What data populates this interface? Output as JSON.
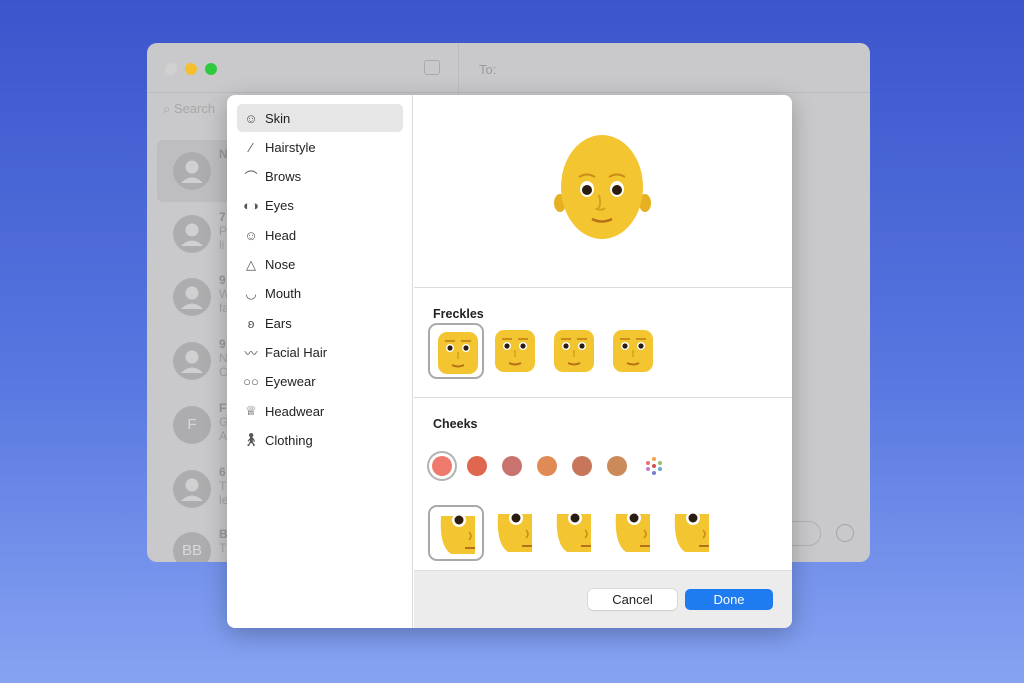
{
  "background_colors": [
    "#3b55cc",
    "#86a3f2"
  ],
  "messages_window": {
    "search_placeholder": "Search",
    "to_label": "To:",
    "traffic_lights": [
      "#d1d1d1",
      "#f5bf2f",
      "#2fc940"
    ],
    "conversations": [
      {
        "avatar": "",
        "lines": [
          "N",
          "",
          ""
        ]
      },
      {
        "avatar": "",
        "lines": [
          "7",
          "P",
          "li"
        ]
      },
      {
        "avatar": "",
        "lines": [
          "9",
          "W",
          "fa"
        ]
      },
      {
        "avatar": "",
        "lines": [
          "9",
          "N",
          "C"
        ]
      },
      {
        "avatar": "F",
        "lines": [
          "F",
          "G",
          "A"
        ]
      },
      {
        "avatar": "",
        "lines": [
          "6",
          "T",
          "le"
        ]
      },
      {
        "avatar": "BB",
        "lines": [
          "B",
          "T",
          ""
        ]
      }
    ]
  },
  "dialog": {
    "nav": [
      {
        "label": "Skin",
        "icon": "smiley-icon",
        "selected": true
      },
      {
        "label": "Hairstyle",
        "icon": "comb-icon"
      },
      {
        "label": "Brows",
        "icon": "brow-icon"
      },
      {
        "label": "Eyes",
        "icon": "eyes-icon"
      },
      {
        "label": "Head",
        "icon": "head-icon"
      },
      {
        "label": "Nose",
        "icon": "nose-icon"
      },
      {
        "label": "Mouth",
        "icon": "mouth-icon"
      },
      {
        "label": "Ears",
        "icon": "ear-icon"
      },
      {
        "label": "Facial Hair",
        "icon": "mustache-icon"
      },
      {
        "label": "Eyewear",
        "icon": "glasses-icon"
      },
      {
        "label": "Headwear",
        "icon": "crown-icon"
      },
      {
        "label": "Clothing",
        "icon": "person-walking-icon"
      }
    ],
    "freckles": {
      "title": "Freckles",
      "options": 4,
      "selected_index": 0
    },
    "cheeks": {
      "title": "Cheeks",
      "colors": [
        "#ee7a6e",
        "#e0674f",
        "#c8736e",
        "#e08a55",
        "#c7765a",
        "#cc8a5a"
      ],
      "selected_color_index": 0,
      "more_colors_icon": "color-picker-dots-icon",
      "options": 5,
      "selected_index": 0
    },
    "skin_color": "#f3c531",
    "cancel_label": "Cancel",
    "done_label": "Done",
    "accent": "#1f7cf0"
  }
}
